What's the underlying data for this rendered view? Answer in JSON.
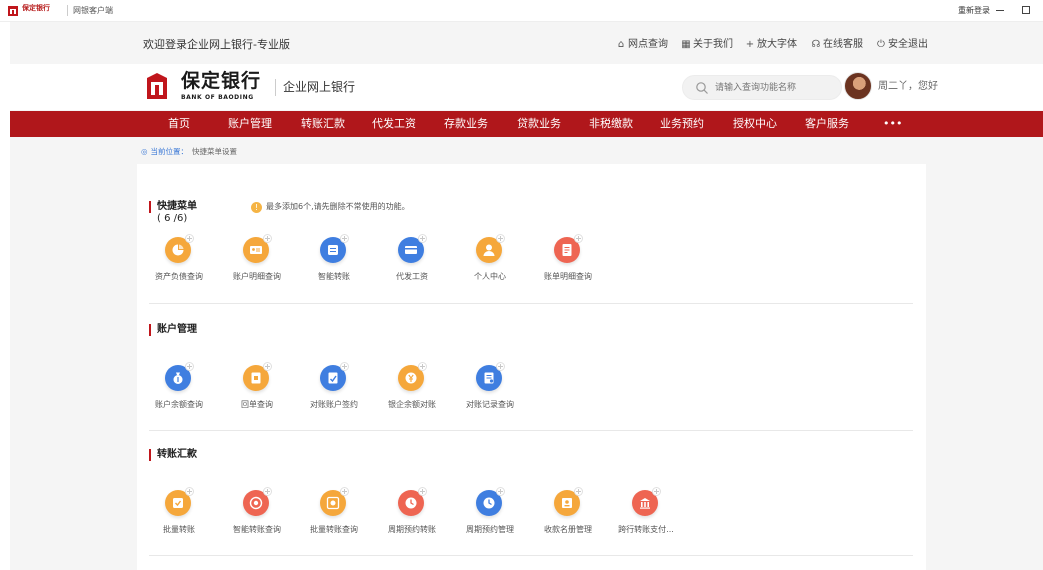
{
  "titlebar": {
    "app_title": "网银客户端",
    "bank_mini": "保定银行",
    "relogin": "重新登录"
  },
  "topbar": {
    "welcome": "欢迎登录企业网上银行-专业版",
    "links": [
      {
        "icon": "outlet-icon",
        "glyph": "⌂",
        "label": "网点查询"
      },
      {
        "icon": "grid-icon",
        "glyph": "▦",
        "label": "关于我们"
      },
      {
        "icon": "plus-icon",
        "glyph": "+",
        "label": "放大字体"
      },
      {
        "icon": "headset-icon",
        "glyph": "☊",
        "label": "在线客服"
      },
      {
        "icon": "power-icon",
        "glyph": "⏻",
        "label": "安全退出"
      }
    ]
  },
  "header": {
    "logo_cn": "保定银行",
    "logo_en": "BANK OF BAODING",
    "subtitle": "企业网上银行",
    "search_placeholder": "请输入查询功能名称",
    "greeting": "周二丫，您好"
  },
  "nav": [
    "首页",
    "账户管理",
    "转账汇款",
    "代发工资",
    "存款业务",
    "贷款业务",
    "非税缴款",
    "业务预约",
    "授权中心",
    "客户服务",
    "•••"
  ],
  "breadcrumb": {
    "label": "当前位置：",
    "current": "快捷菜单设置"
  },
  "colors": {
    "brand_red": "#b0171b",
    "orange": "#f5a73b",
    "blue": "#3f7ee0",
    "coral": "#ee6552"
  },
  "sections": [
    {
      "title": "快捷菜单",
      "count": "( 6 /6)",
      "note": "最多添加6个,请先删除不常使用的功能。",
      "items": [
        {
          "label": "资产负债查询",
          "color": "#f5a73b",
          "icon": "pie-chart-icon"
        },
        {
          "label": "账户明细查询",
          "color": "#f5a73b",
          "icon": "id-card-icon"
        },
        {
          "label": "智能转账",
          "color": "#3f7ee0",
          "icon": "transfer-icon"
        },
        {
          "label": "代发工资",
          "color": "#3f7ee0",
          "icon": "card-icon"
        },
        {
          "label": "个人中心",
          "color": "#f5a73b",
          "icon": "user-icon"
        },
        {
          "label": "账单明细查询",
          "color": "#ee6552",
          "icon": "bill-icon"
        }
      ]
    },
    {
      "title": "账户管理",
      "items": [
        {
          "label": "账户余额查询",
          "color": "#3f7ee0",
          "icon": "money-bag-icon"
        },
        {
          "label": "回单查询",
          "color": "#f5a73b",
          "icon": "receipt-icon"
        },
        {
          "label": "对账账户签约",
          "color": "#3f7ee0",
          "icon": "sign-icon"
        },
        {
          "label": "银企余额对账",
          "color": "#f5a73b",
          "icon": "yuan-icon"
        },
        {
          "label": "对账记录查询",
          "color": "#3f7ee0",
          "icon": "record-icon"
        }
      ]
    },
    {
      "title": "转账汇款",
      "items": [
        {
          "label": "批量转账",
          "color": "#f5a73b",
          "icon": "batch-icon"
        },
        {
          "label": "智能转账查询",
          "color": "#ee6552",
          "icon": "target-icon"
        },
        {
          "label": "批量转账查询",
          "color": "#f5a73b",
          "icon": "batch-search-icon"
        },
        {
          "label": "周期预约转账",
          "color": "#ee6552",
          "icon": "clock-icon"
        },
        {
          "label": "周期预约管理",
          "color": "#3f7ee0",
          "icon": "clock-manage-icon"
        },
        {
          "label": "收款名册管理",
          "color": "#f5a73b",
          "icon": "contacts-icon"
        },
        {
          "label": "跨行转账支付...",
          "color": "#ee6552",
          "icon": "bank-transfer-icon"
        }
      ]
    }
  ]
}
